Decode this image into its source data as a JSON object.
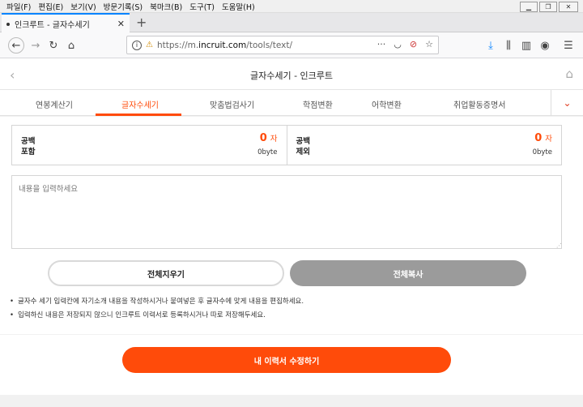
{
  "browser": {
    "menu": [
      "파일(F)",
      "편집(E)",
      "보기(V)",
      "방문기록(S)",
      "북마크(B)",
      "도구(T)",
      "도움말(H)"
    ],
    "tab_title": "인크루트 - 글자수세기",
    "url_prefix": "https://m.",
    "url_domain": "incruit.com",
    "url_path": "/tools/text/",
    "accent": "#0a84ff"
  },
  "app": {
    "title": "글자수세기 - 인크루트",
    "tabs": [
      {
        "label": "연봉계산기"
      },
      {
        "label": "글자수세기"
      },
      {
        "label": "맞춤법검사기"
      },
      {
        "label": "학점변환"
      },
      {
        "label": "어학변환"
      },
      {
        "label": "취업활동증명서"
      }
    ],
    "active_tab": "글자수세기",
    "brand_color": "#ff4b0a"
  },
  "counters": {
    "with_space": {
      "label1": "공백",
      "label2": "포함",
      "count": "0",
      "unit": "자",
      "bytes": "0byte"
    },
    "without_space": {
      "label1": "공백",
      "label2": "제외",
      "count": "0",
      "unit": "자",
      "bytes": "0byte"
    }
  },
  "editor": {
    "placeholder": "내용을 입력하세요"
  },
  "buttons": {
    "clear": "전체지우기",
    "copy": "전체복사",
    "edit_resume": "내 이력서 수정하기"
  },
  "notes": [
    "글자수 세기 입력칸에 자기소개 내용을 작성하시거나 붙여넣은 후 글자수에 맞게 내용을 편집하세요.",
    "입력하신 내용은 저장되지 않으니 인크루트 이력서로 등록하시거나 따로 저장해두세요."
  ]
}
